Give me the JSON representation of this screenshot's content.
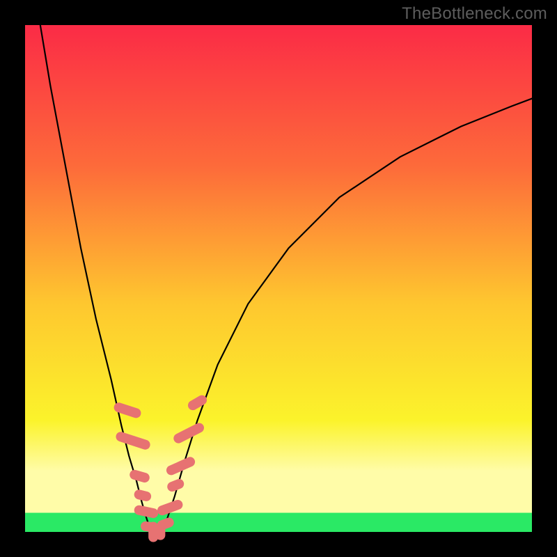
{
  "watermark": "TheBottleneck.com",
  "palette": {
    "top": "#fb2b46",
    "upper": "#fd6b3a",
    "mid": "#fec72f",
    "lower": "#fbf32b",
    "pale": "#fffca8",
    "green": "#2ae965",
    "bead": "#e77272"
  },
  "chart_data": {
    "type": "line",
    "title": "",
    "xlabel": "",
    "ylabel": "",
    "xlim": [
      0,
      100
    ],
    "ylim": [
      0,
      100
    ],
    "series": [
      {
        "name": "left-curve",
        "x": [
          3,
          5,
          8,
          11,
          14,
          17,
          19,
          20.5,
          22,
          23,
          23.8,
          24.4,
          25
        ],
        "y": [
          100,
          88,
          72,
          56,
          42,
          30,
          21,
          15,
          10,
          6,
          3.2,
          1.4,
          0
        ]
      },
      {
        "name": "floor",
        "x": [
          25,
          27
        ],
        "y": [
          0,
          0
        ]
      },
      {
        "name": "right-curve",
        "x": [
          27,
          28,
          29.5,
          31.5,
          34,
          38,
          44,
          52,
          62,
          74,
          86,
          96,
          100
        ],
        "y": [
          0,
          2.5,
          7,
          14,
          22,
          33,
          45,
          56,
          66,
          74,
          80,
          84,
          85.5
        ]
      }
    ],
    "annotations": {
      "beads_note": "pink rounded beads clustered near the valley on both curves",
      "left_beads": [
        {
          "x": 20.2,
          "y": 24.0,
          "len": 5.5,
          "ang": -72
        },
        {
          "x": 21.3,
          "y": 18.0,
          "len": 7.0,
          "ang": -72
        },
        {
          "x": 22.6,
          "y": 11.0,
          "len": 4.0,
          "ang": -74
        },
        {
          "x": 23.2,
          "y": 7.2,
          "len": 3.4,
          "ang": -76
        },
        {
          "x": 23.9,
          "y": 4.0,
          "len": 4.8,
          "ang": -78
        },
        {
          "x": 24.6,
          "y": 1.0,
          "len": 3.6,
          "ang": -82
        }
      ],
      "floor_beads": [
        {
          "x": 25.3,
          "y": 0.0,
          "len": 4.0,
          "ang": 0
        },
        {
          "x": 26.7,
          "y": 0.0,
          "len": 3.2,
          "ang": 0
        }
      ],
      "right_beads": [
        {
          "x": 27.7,
          "y": 1.6,
          "len": 3.4,
          "ang": 70
        },
        {
          "x": 28.6,
          "y": 4.8,
          "len": 5.2,
          "ang": 70
        },
        {
          "x": 29.7,
          "y": 9.2,
          "len": 3.4,
          "ang": 68
        },
        {
          "x": 30.7,
          "y": 13.0,
          "len": 6.0,
          "ang": 66
        },
        {
          "x": 32.3,
          "y": 19.5,
          "len": 6.5,
          "ang": 63
        },
        {
          "x": 34.0,
          "y": 25.5,
          "len": 4.0,
          "ang": 60
        }
      ]
    }
  }
}
